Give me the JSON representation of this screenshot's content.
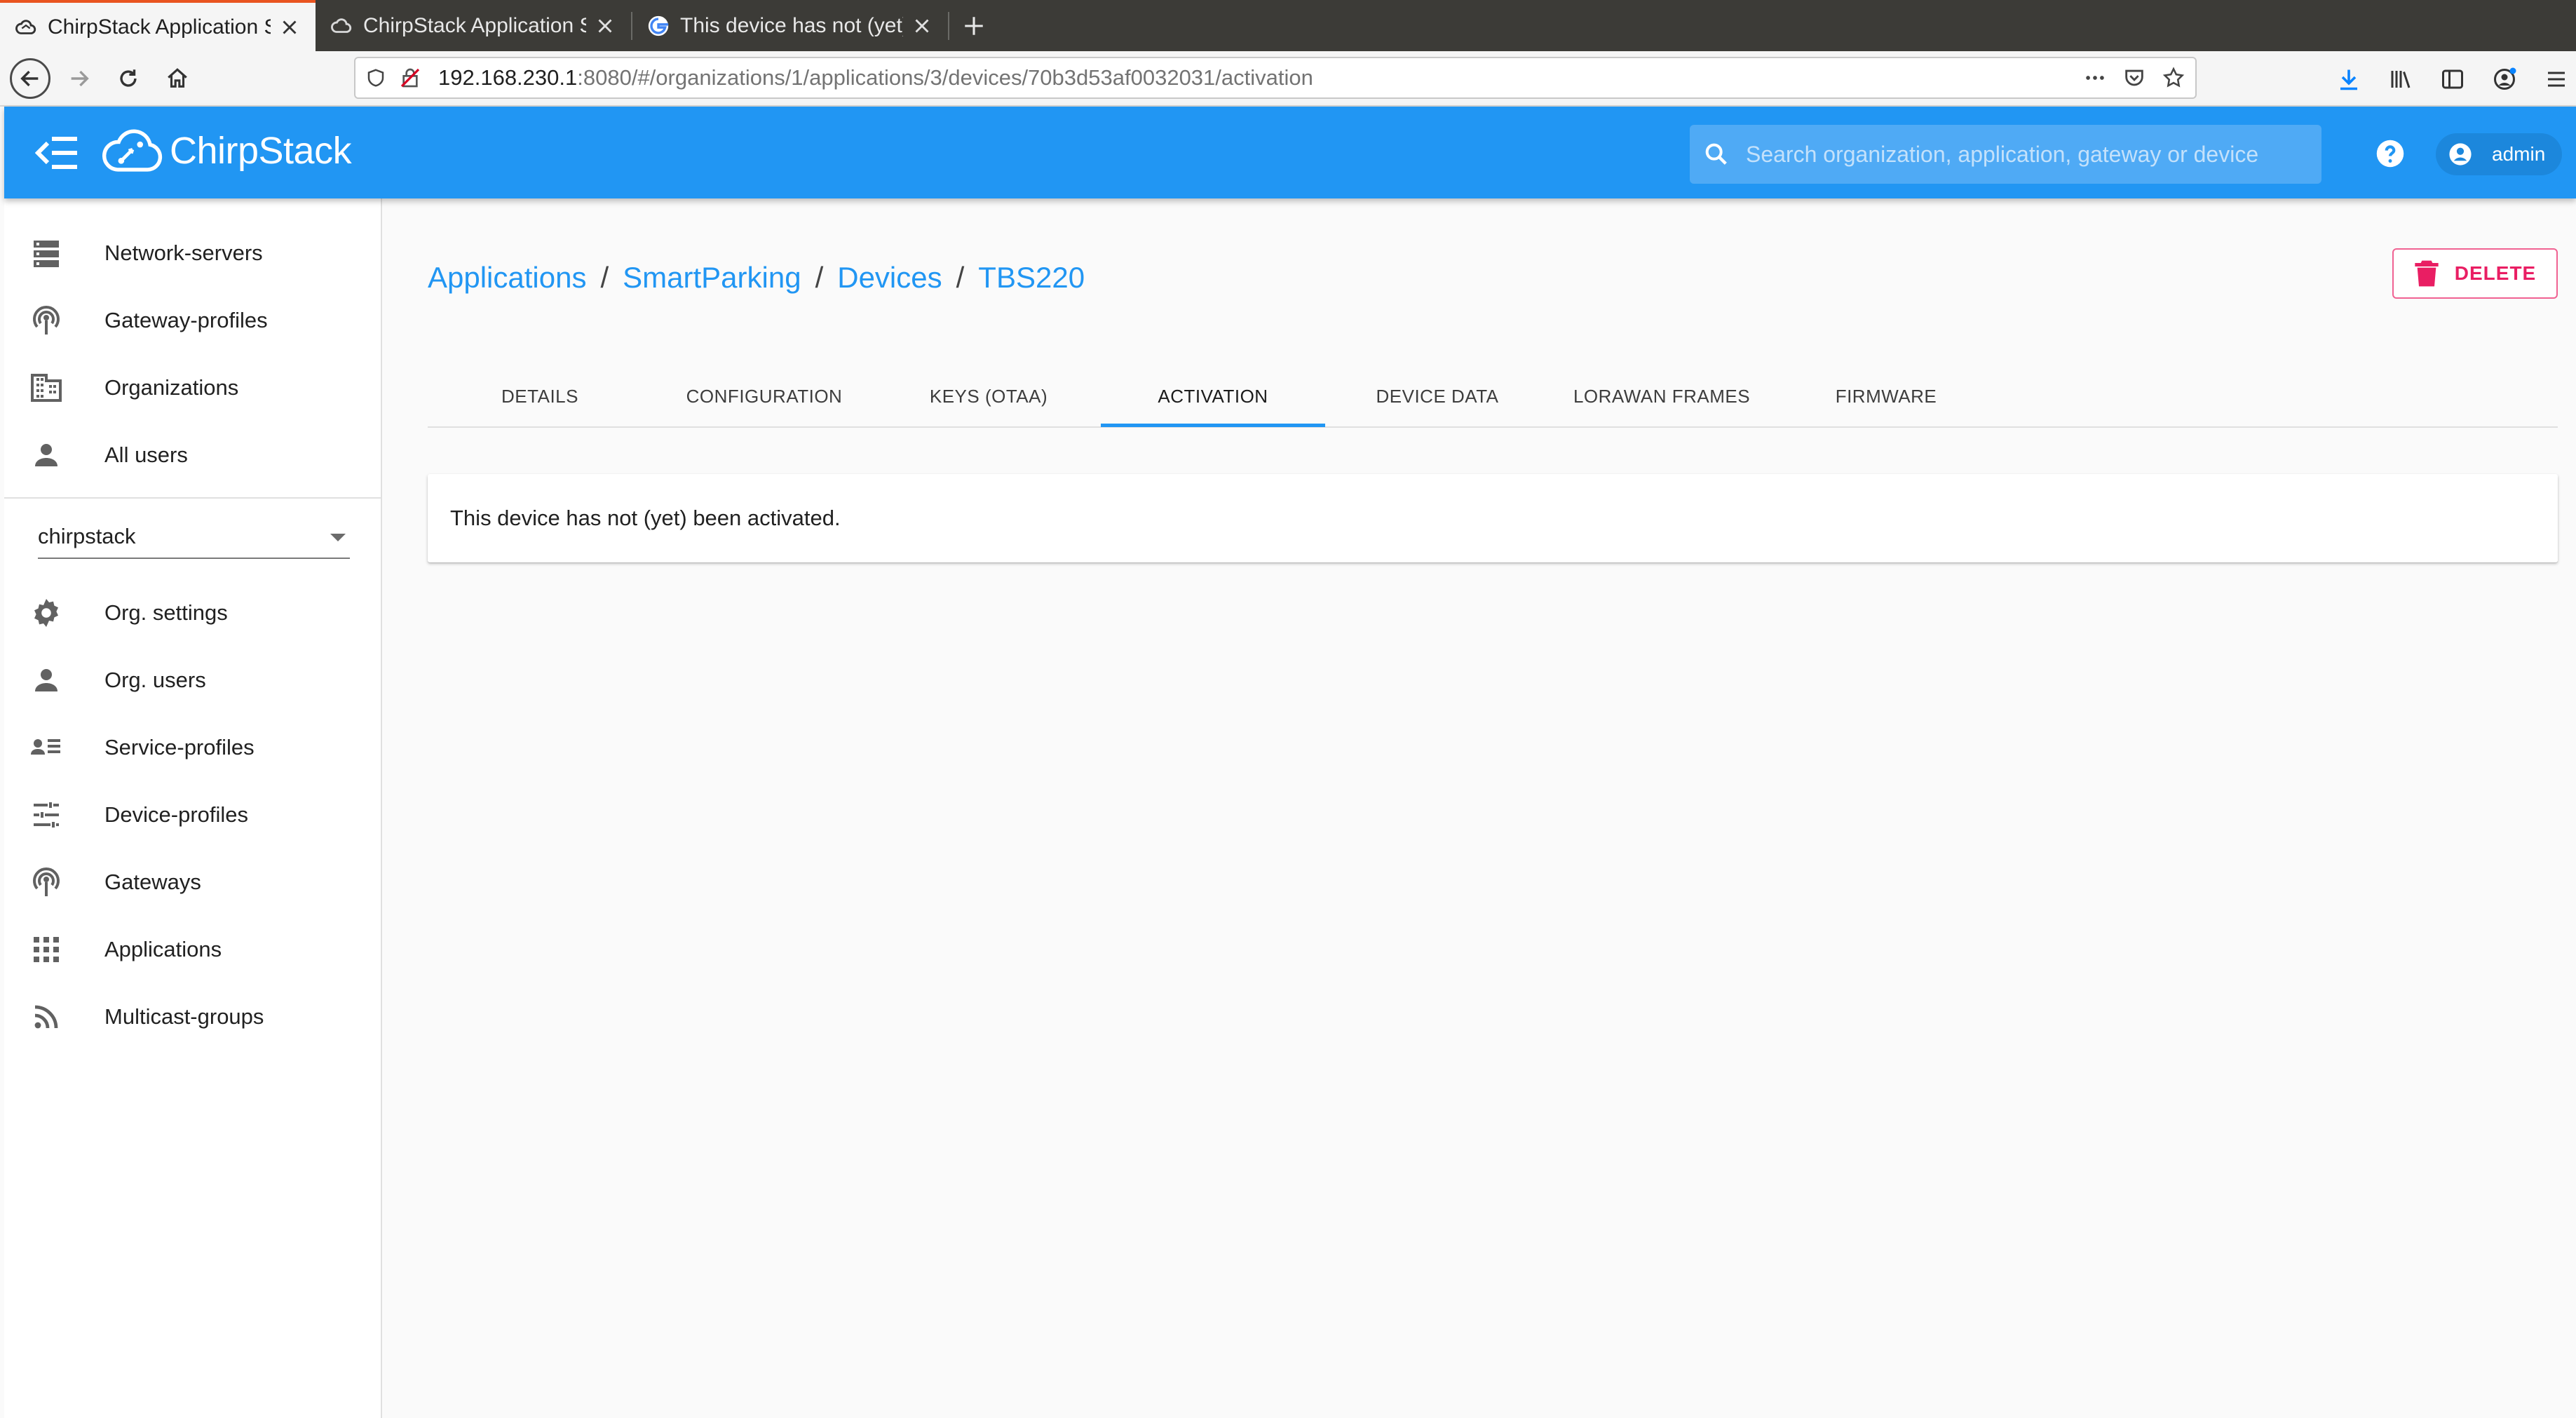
{
  "browser": {
    "tabs": [
      {
        "title": "ChirpStack Application S",
        "active": true
      },
      {
        "title": "ChirpStack Application S",
        "active": false
      },
      {
        "title": "This device has not (yet)",
        "active": false
      }
    ],
    "url_host": "192.168.230.1",
    "url_rest": ":8080/#/organizations/1/applications/3/devices/70b3d53af0032031/activation"
  },
  "header": {
    "logo_text": "ChirpStack",
    "search_placeholder": "Search organization, application, gateway or device",
    "user": "admin",
    "color": "#2196f3"
  },
  "sidebar": {
    "global_items": [
      {
        "label": "Network-servers",
        "icon": "server-icon"
      },
      {
        "label": "Gateway-profiles",
        "icon": "antenna-icon"
      },
      {
        "label": "Organizations",
        "icon": "building-icon"
      },
      {
        "label": "All users",
        "icon": "person-icon"
      }
    ],
    "org_select_value": "chirpstack",
    "org_items": [
      {
        "label": "Org. settings",
        "icon": "gear-icon"
      },
      {
        "label": "Org. users",
        "icon": "person-icon"
      },
      {
        "label": "Service-profiles",
        "icon": "account-details-icon"
      },
      {
        "label": "Device-profiles",
        "icon": "tune-icon"
      },
      {
        "label": "Gateways",
        "icon": "antenna-icon"
      },
      {
        "label": "Applications",
        "icon": "apps-grid-icon"
      },
      {
        "label": "Multicast-groups",
        "icon": "rss-icon"
      }
    ]
  },
  "breadcrumb": [
    "Applications",
    "SmartParking",
    "Devices",
    "TBS220"
  ],
  "delete_label": "DELETE",
  "tabs": [
    "DETAILS",
    "CONFIGURATION",
    "KEYS (OTAA)",
    "ACTIVATION",
    "DEVICE DATA",
    "LORAWAN FRAMES",
    "FIRMWARE"
  ],
  "active_tab": "ACTIVATION",
  "message": "This device has not (yet) been activated."
}
